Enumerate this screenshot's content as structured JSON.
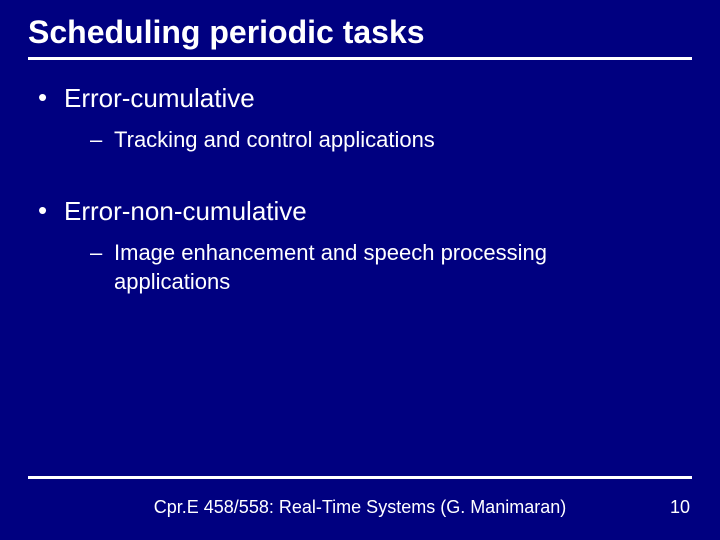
{
  "title": "Scheduling periodic tasks",
  "items": [
    {
      "label": "Error-cumulative",
      "sub": [
        "Tracking and control applications"
      ]
    },
    {
      "label": "Error-non-cumulative",
      "sub": [
        "Image enhancement and speech processing applications"
      ]
    }
  ],
  "footer": {
    "course": "Cpr.E 458/558: Real-Time Systems (G. Manimaran)",
    "page": "10"
  }
}
